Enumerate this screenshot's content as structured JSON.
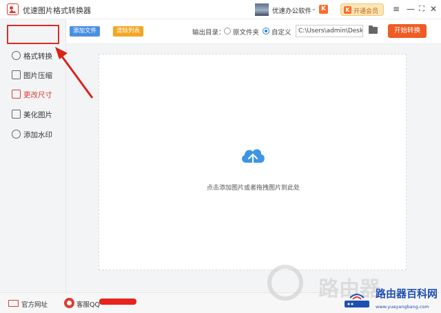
{
  "app": {
    "title": "优速图片格式转换器"
  },
  "header": {
    "user_name": "优速办公软件",
    "user_caret": "⌄",
    "user_badge": "K",
    "vip_icon": "K",
    "vip_label": "开通会员",
    "window_buttons": [
      "≡",
      "—",
      "⛶",
      "✕"
    ]
  },
  "sidebar": {
    "items": [
      {
        "label": "格式转换",
        "icon": "format-convert-icon",
        "active": true
      },
      {
        "label": "图片压缩",
        "icon": "compress-icon"
      },
      {
        "label": "更改尺寸",
        "icon": "resize-icon",
        "color": "#e03a2f"
      },
      {
        "label": "美化图片",
        "icon": "beautify-icon"
      },
      {
        "label": "添加水印",
        "icon": "watermark-icon"
      }
    ]
  },
  "toolbar": {
    "add_label": "添加文件",
    "clear_label": "清除列表",
    "output_label": "输出目录：",
    "option_source": "原文件夹",
    "option_custom": "自定义",
    "selected_option": "自定义",
    "path_value": "C:\\Users\\admin\\Deskto",
    "start_label": "开始转换"
  },
  "main": {
    "drop_hint": "点击添加图片或者拖拽图片到此处"
  },
  "footer": {
    "site_label": "官方网址",
    "cs_label": "客服QQ"
  },
  "watermark": {
    "big_text": "路由器",
    "site_name": "路由器百科网",
    "url": "www.yueyangbang.com"
  },
  "colors": {
    "accent": "#f05a24",
    "blue": "#4a90e2",
    "orange": "#f5a623",
    "red": "#e03a2f",
    "highlight": "#e02b20"
  }
}
